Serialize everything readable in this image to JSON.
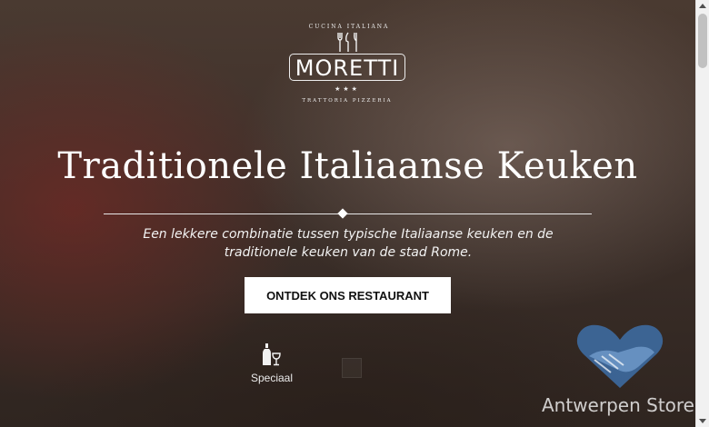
{
  "logo": {
    "top_text": "CUCINA ITALIANA",
    "name": "MORETTI",
    "stars": "★★★",
    "bottom_text": "TRATTORIA PIZZERIA"
  },
  "hero": {
    "title": "Traditionele Italiaanse Keuken",
    "subtitle": "Een lekkere combinatie tussen typische Italiaanse keuken en de traditionele keuken van de stad Rome.",
    "cta_label": "ONTDEK ONS RESTAURANT"
  },
  "features": [
    {
      "label": "Speciaal",
      "icon": "wine-bottle-glass-icon"
    }
  ],
  "watermark": {
    "text": "Antwerpen Store",
    "icon": "handshake-heart-icon"
  },
  "colors": {
    "cta_bg": "#ffffff",
    "text": "#ffffff",
    "watermark_blue": "#3d6aa0"
  }
}
